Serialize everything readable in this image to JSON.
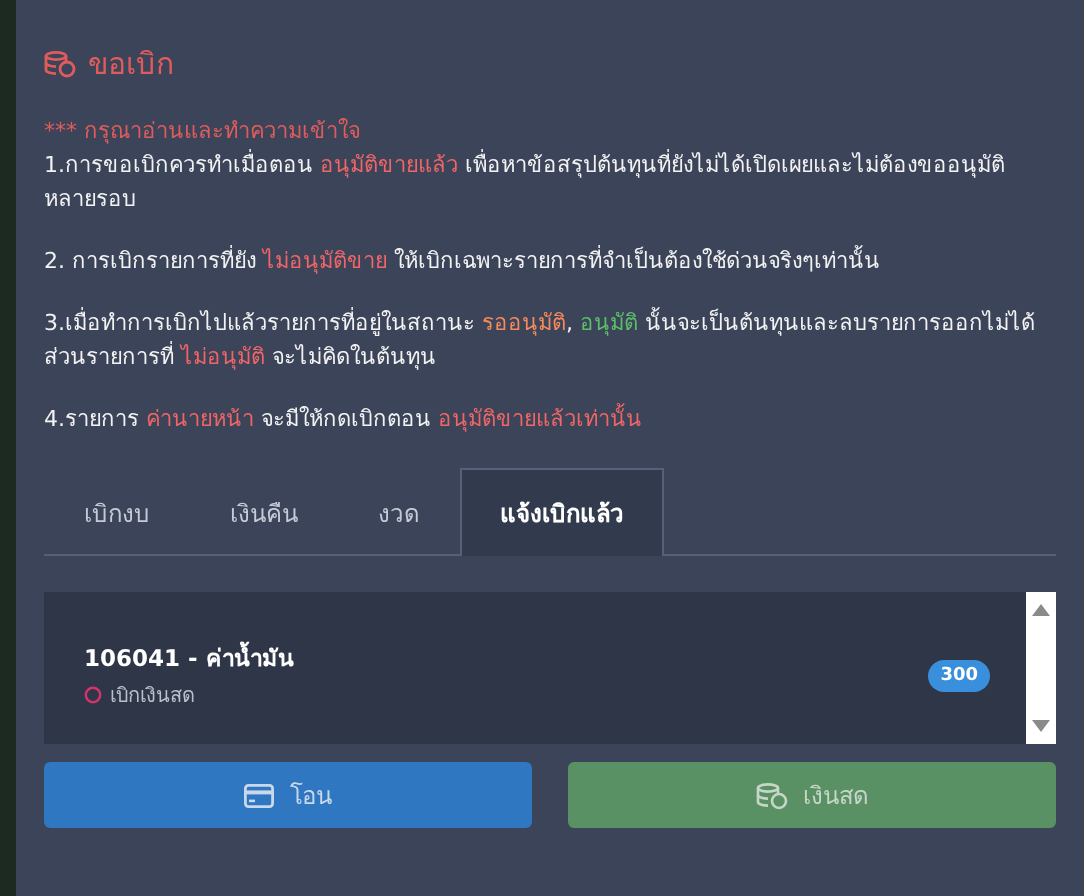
{
  "title": "ขอเบิก",
  "notice": "*** กรุณาอ่านและทำความเข้าใจ",
  "rules": [
    [
      {
        "text": "1.การขอเบิกควรทำเมื่อตอน "
      },
      {
        "text": "อนุมัติขายแล้ว",
        "color": "#f06565"
      },
      {
        "text": " เพื่อหาข้อสรุปต้นทุนที่ยังไม่ได้เปิดเผยและไม่ต้องขออนุมัติหลายรอบ"
      }
    ],
    [
      {
        "text": "2. การเบิกรายการที่ยัง "
      },
      {
        "text": "ไม่อนุมัติขาย",
        "color": "#f06565"
      },
      {
        "text": " ให้เบิกเฉพาะรายการที่จำเป็นต้องใช้ด่วนจริงๆเท่านั้น"
      }
    ],
    [
      {
        "text": "3.เมื่อทำการเบิกไปแล้วรายการที่อยู่ในสถานะ "
      },
      {
        "text": "รออนุมัติ",
        "color": "#f58a5a"
      },
      {
        "text": ", "
      },
      {
        "text": "อนุมัติ",
        "color": "#5dbd69"
      },
      {
        "text": " นั้นจะเป็นต้นทุนและลบรายการออกไม่ได้ ส่วนรายการที่ "
      },
      {
        "text": "ไม่อนุมัติ",
        "color": "#f06565"
      },
      {
        "text": " จะไม่คิดในต้นทุน"
      }
    ],
    [
      {
        "text": "4.รายการ "
      },
      {
        "text": "ค่านายหน้า",
        "color": "#f06565"
      },
      {
        "text": " จะมีให้กดเบิกตอน "
      },
      {
        "text": "อนุมัติขายแล้วเท่านั้น",
        "color": "#f06565"
      }
    ]
  ],
  "tabs": [
    {
      "label": "เบิกงบ",
      "selected": false
    },
    {
      "label": "เงินคืน",
      "selected": false
    },
    {
      "label": "งวด",
      "selected": false
    },
    {
      "label": "แจ้งเบิกแล้ว",
      "selected": true
    }
  ],
  "items": [
    {
      "title": "106041 - ค่าน้ำมัน",
      "method": "เบิกเงินสด",
      "amount": "300"
    }
  ],
  "buttons": [
    {
      "label": "โอน",
      "kind": "transfer"
    },
    {
      "label": "เงินสด",
      "kind": "cash"
    }
  ]
}
